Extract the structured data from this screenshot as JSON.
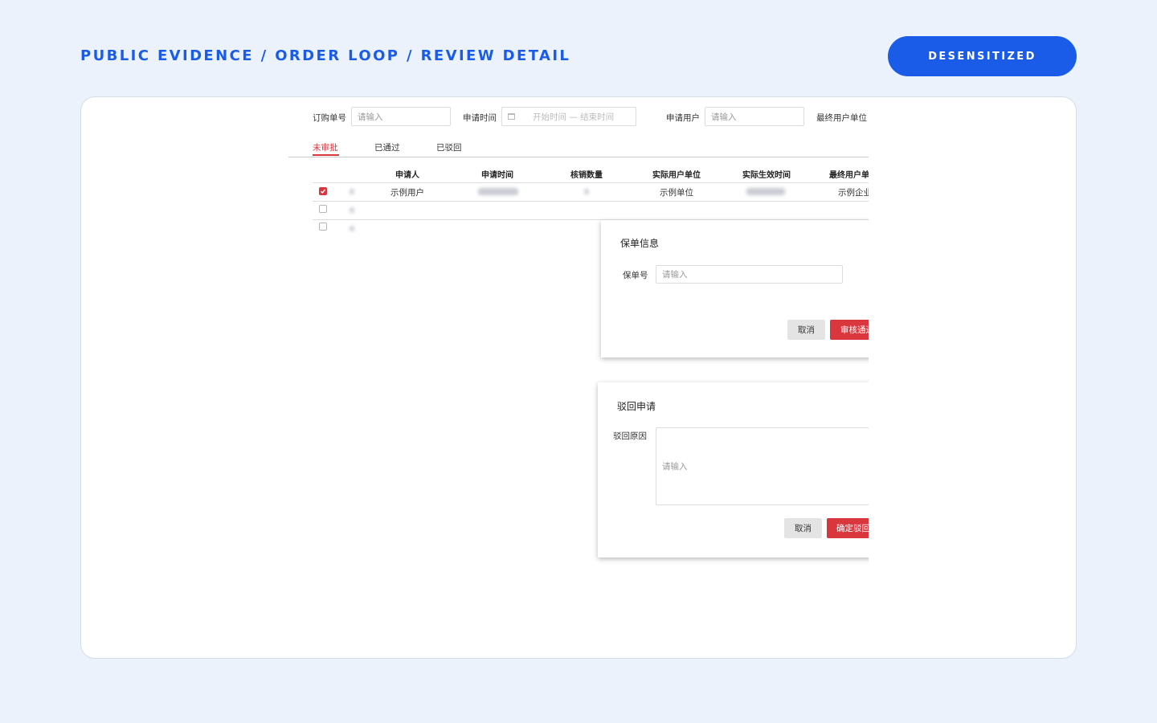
{
  "header": {
    "title": "PUBLIC EVIDENCE / ORDER LOOP / REVIEW DETAIL",
    "badge": "DESENSITIZED"
  },
  "filters": {
    "order_no": {
      "label": "订购单号",
      "placeholder": "请输入"
    },
    "apply_time": {
      "label": "申请时间",
      "placeholder": "开始时间 — 结束时间"
    },
    "apply_user": {
      "label": "申请用户",
      "placeholder": "请输入"
    },
    "end_user_unit": {
      "label": "最终用户单位"
    }
  },
  "tabs": [
    {
      "label": "未审批",
      "active": true
    },
    {
      "label": "已通过",
      "active": false
    },
    {
      "label": "已驳回",
      "active": false
    }
  ],
  "table": {
    "columns": [
      "申请人",
      "申请时间",
      "核销数量",
      "实际用户单位",
      "实际生效时间",
      "最终用户单"
    ],
    "rows": [
      {
        "checked": true,
        "applicant": "示例用户",
        "actual_unit": "示例单位",
        "end_unit": "示例企业"
      },
      {
        "checked": false
      },
      {
        "checked": false
      }
    ]
  },
  "policy_dialog": {
    "title": "保单信息",
    "field_label": "保单号",
    "placeholder": "请输入",
    "cancel": "取消",
    "confirm": "审核通过"
  },
  "reject_dialog": {
    "title": "驳回申请",
    "field_label": "驳回原因",
    "placeholder": "请输入",
    "cancel": "取消",
    "confirm": "确定驳回"
  },
  "colors": {
    "accent": "#1a5ce8",
    "danger": "#d9363e",
    "background": "#ecf2fc"
  }
}
